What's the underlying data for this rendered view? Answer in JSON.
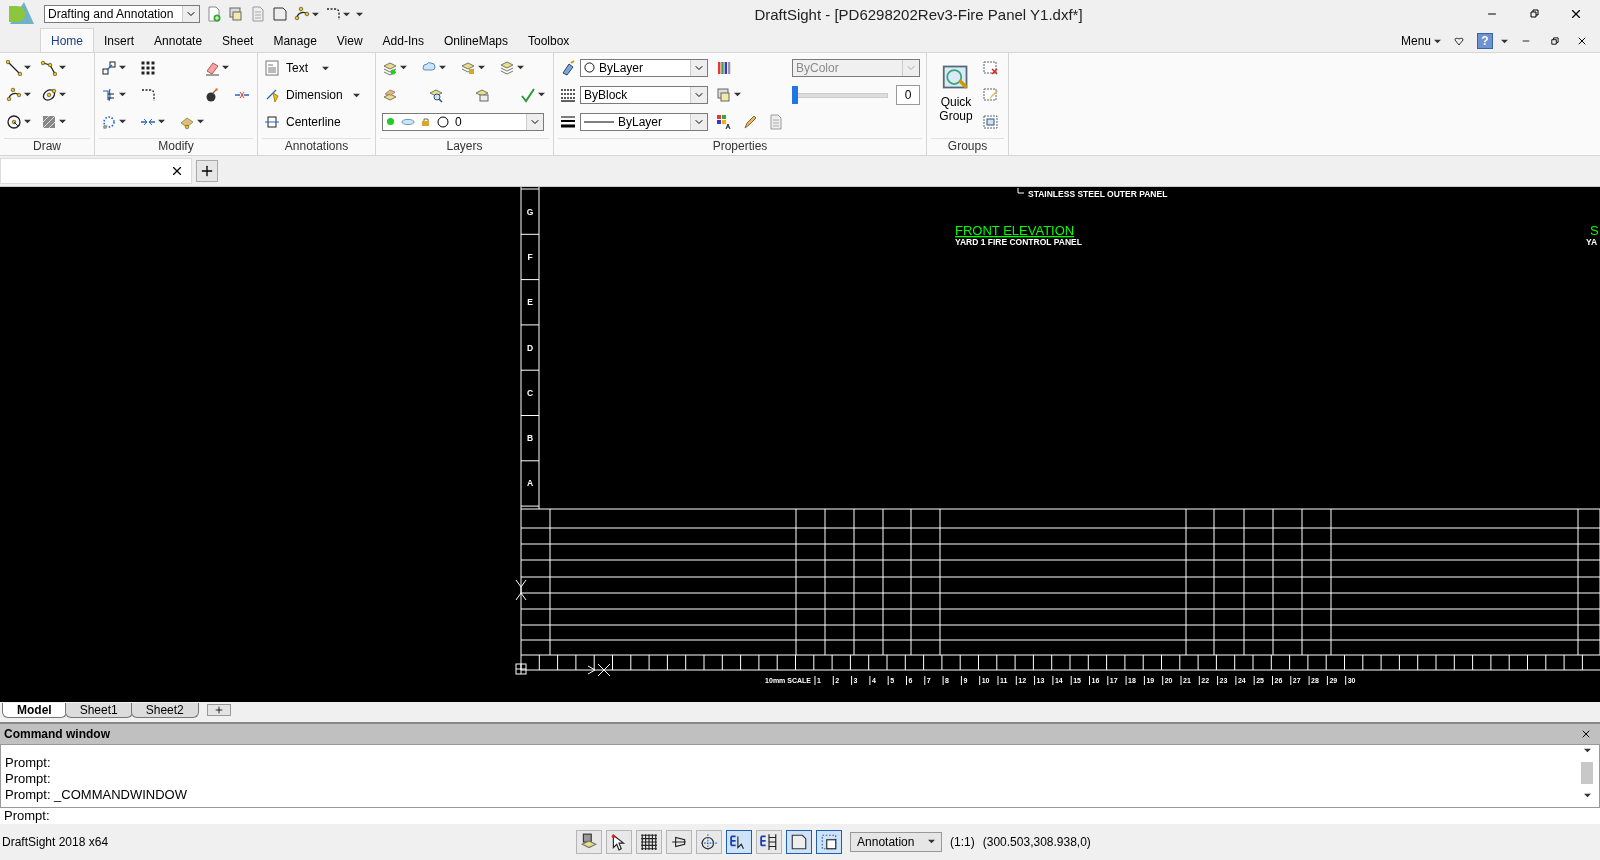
{
  "workspace": {
    "value": "Drafting and Annotation"
  },
  "title": "DraftSight - [PD6298202Rev3-Fire Panel Y1.dxf*]",
  "ribbon_tabs": [
    {
      "label": "Home",
      "selected": true
    },
    {
      "label": "Insert",
      "selected": false
    },
    {
      "label": "Annotate",
      "selected": false
    },
    {
      "label": "Sheet",
      "selected": false
    },
    {
      "label": "Manage",
      "selected": false
    },
    {
      "label": "View",
      "selected": false
    },
    {
      "label": "Add-Ins",
      "selected": false
    },
    {
      "label": "OnlineMaps",
      "selected": false
    },
    {
      "label": "Toolbox",
      "selected": false
    }
  ],
  "menu_button": "Menu",
  "help_button": "?",
  "ribbon": {
    "draw": {
      "label": "Draw"
    },
    "modify": {
      "label": "Modify"
    },
    "annotations": {
      "label": "Annotations",
      "buttons": [
        "Text",
        "Dimension",
        "Centerline"
      ]
    },
    "layers": {
      "label": "Layers",
      "layer_combo": "0"
    },
    "properties": {
      "label": "Properties",
      "color_setting": "ByLayer",
      "linestyle": "ByBlock",
      "lineweight": "ByLayer",
      "plot_style": {
        "value": "ByColor",
        "disabled": true
      },
      "transparency": {
        "level": 0,
        "value": "0"
      }
    },
    "groups": {
      "label": "Groups",
      "quick_group": "Quick Group"
    }
  },
  "drawing": {
    "zone_letters": [
      "G",
      "F",
      "E",
      "D",
      "C",
      "B",
      "A"
    ],
    "note": "STAINLESS STEEL OUTER PANEL",
    "view_title": "FRONT ELEVATION",
    "view_subtitle": "YARD 1 FIRE CONTROL PANEL",
    "cut_title": "S",
    "cut_subtitle": "YA",
    "scale_title": "10mm SCALE",
    "scale_labels": [
      "1",
      "2",
      "3",
      "4",
      "5",
      "6",
      "7",
      "8",
      "9",
      "10",
      "11",
      "12",
      "13",
      "14",
      "15",
      "16",
      "17",
      "18",
      "19",
      "20",
      "21",
      "22",
      "23",
      "24",
      "25",
      "26",
      "27",
      "28",
      "29",
      "30"
    ]
  },
  "sheet_tabs": [
    {
      "label": "Model",
      "selected": true
    },
    {
      "label": "Sheet1",
      "selected": false
    },
    {
      "label": "Sheet2",
      "selected": false
    }
  ],
  "command_window": {
    "title": "Command window",
    "history": [
      "Prompt:",
      "Prompt:",
      "Prompt: _COMMANDWINDOW"
    ],
    "prompt": "Prompt:"
  },
  "status_bar": {
    "app_version": "DraftSight 2018 x64",
    "toggles": [
      {
        "on": false
      },
      {
        "on": false
      },
      {
        "on": false
      },
      {
        "on": false
      },
      {
        "on": false
      },
      {
        "on": true
      },
      {
        "on": false
      },
      {
        "on": true
      },
      {
        "on": true
      }
    ],
    "annotation_scale": "Annotation",
    "scale": "(1:1)",
    "coordinates": "(300.503,308.938,0)"
  }
}
